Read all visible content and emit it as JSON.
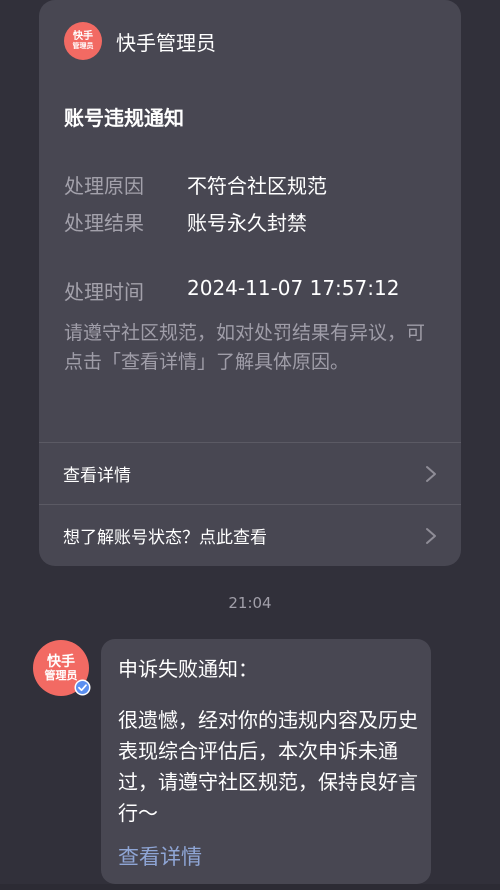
{
  "card": {
    "sender_logo_line1": "快手",
    "sender_logo_line2": "管理员",
    "sender_name": "快手管理员",
    "title": "账号违规通知",
    "reason_label": "处理原因",
    "reason_value": "不符合社区规范",
    "result_label": "处理结果",
    "result_value": "账号永久封禁",
    "time_label": "处理时间",
    "time_value": "2024-11-07 17:57:12",
    "note": "请遵守社区规范，如对处罚结果有异议，可点击「查看详情」了解具体原因。",
    "link_details": "查看详情",
    "link_status": "想了解账号状态？点此查看"
  },
  "timestamp": "21:04",
  "message": {
    "avatar_line1": "快手",
    "avatar_line2": "管理员",
    "title": "申诉失败通知：",
    "body": "很遗憾，经对你的违规内容及历史表现综合评估后，本次申诉未通过，请遵守社区规范，保持良好言行～",
    "link": "查看详情"
  },
  "icons": {
    "chevron": "chevron-right-icon",
    "verified": "verified-badge-icon"
  },
  "colors": {
    "background": "#31303a",
    "card": "#484752",
    "brand": "#f26a63",
    "link": "#8fa6d6",
    "verified": "#5b8ff0"
  }
}
